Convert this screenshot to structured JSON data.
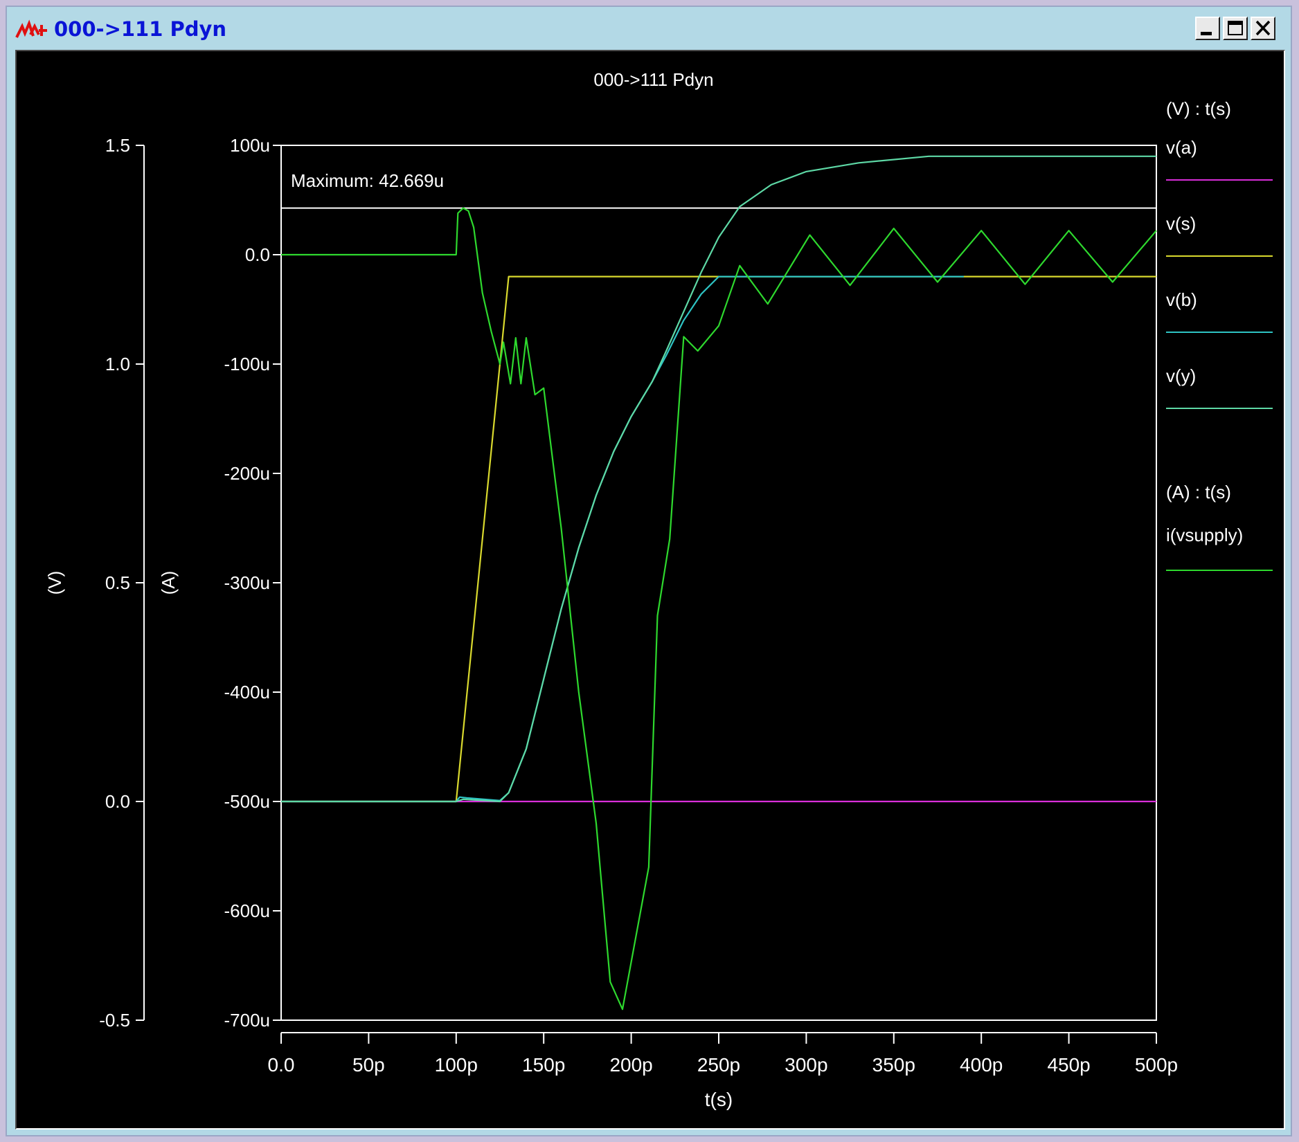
{
  "window": {
    "title": "000->111 Pdyn",
    "icon": "waveform-app-icon",
    "controls": [
      "minimize",
      "maximize",
      "close"
    ]
  },
  "colors": {
    "titlebar_bg": "#b3d9e6",
    "title_text": "#0a14d6",
    "plot_bg": "#000000",
    "v_a": "#d92ed9",
    "v_s": "#d9d92e",
    "v_b": "#2ec4c4",
    "v_y": "#5ed9a6",
    "i_vsupply": "#2ed92e"
  },
  "chart_data": {
    "type": "line",
    "title": "000->111 Pdyn",
    "xlabel": "t(s)",
    "x_tick_labels": [
      "0.0",
      "50p",
      "100p",
      "150p",
      "200p",
      "250p",
      "300p",
      "350p",
      "400p",
      "450p",
      "500p"
    ],
    "xlim": [
      0,
      500
    ],
    "x_unit": "ps",
    "left_axis": {
      "label": "(V)",
      "ylim": [
        -0.5,
        1.5
      ],
      "tick_labels": [
        "1.5",
        "1.0",
        "0.5",
        "0.0",
        "-0.5"
      ]
    },
    "right_axis": {
      "label": "(A)",
      "ylim": [
        -700,
        100
      ],
      "tick_labels": [
        "100u",
        "0.0",
        "-100u",
        "-200u",
        "-300u",
        "-400u",
        "-500u",
        "-600u",
        "-700u"
      ]
    },
    "annotation": {
      "text": "Maximum: 42.669u",
      "value_uA": 42.669
    },
    "legend": {
      "placement": "right",
      "voltage_header": "(V) : t(s)",
      "current_header": "(A) : t(s)"
    },
    "series": [
      {
        "name": "v(a)",
        "axis": "V",
        "color": "#d92ed9",
        "points": [
          [
            0,
            0
          ],
          [
            500,
            0
          ]
        ]
      },
      {
        "name": "v(s)",
        "axis": "V",
        "color": "#d9d92e",
        "points": [
          [
            0,
            0
          ],
          [
            100,
            0
          ],
          [
            130,
            1.2
          ],
          [
            500,
            1.2
          ]
        ]
      },
      {
        "name": "v(b)",
        "axis": "V",
        "color": "#2ec4c4",
        "points": [
          [
            0,
            0
          ],
          [
            100,
            0
          ],
          [
            102,
            0.01
          ],
          [
            106,
            0.008
          ],
          [
            125,
            0.002
          ],
          [
            130,
            0.02
          ],
          [
            140,
            0.12
          ],
          [
            150,
            0.28
          ],
          [
            160,
            0.44
          ],
          [
            170,
            0.58
          ],
          [
            180,
            0.7
          ],
          [
            190,
            0.8
          ],
          [
            200,
            0.88
          ],
          [
            212,
            0.96
          ],
          [
            220,
            1.02
          ],
          [
            230,
            1.1
          ],
          [
            240,
            1.16
          ],
          [
            250,
            1.2
          ],
          [
            260,
            1.2
          ],
          [
            270,
            1.2
          ],
          [
            300,
            1.2
          ],
          [
            390,
            1.2
          ]
        ]
      },
      {
        "name": "v(y)",
        "axis": "V",
        "color": "#5ed9a6",
        "points": [
          [
            0,
            0
          ],
          [
            100,
            0
          ],
          [
            104,
            0.005
          ],
          [
            125,
            0.0
          ],
          [
            130,
            0.02
          ],
          [
            140,
            0.12
          ],
          [
            150,
            0.28
          ],
          [
            160,
            0.44
          ],
          [
            170,
            0.58
          ],
          [
            180,
            0.7
          ],
          [
            190,
            0.8
          ],
          [
            200,
            0.88
          ],
          [
            212,
            0.96
          ],
          [
            220,
            1.03
          ],
          [
            230,
            1.12
          ],
          [
            240,
            1.21
          ],
          [
            250,
            1.29
          ],
          [
            262,
            1.36
          ],
          [
            280,
            1.41
          ],
          [
            300,
            1.44
          ],
          [
            330,
            1.46
          ],
          [
            370,
            1.475
          ],
          [
            500,
            1.475
          ]
        ]
      },
      {
        "name": "i(vsupply)",
        "axis": "A",
        "color": "#2ed92e",
        "points": [
          [
            0,
            0
          ],
          [
            100,
            0
          ],
          [
            101,
            38
          ],
          [
            104,
            42.669
          ],
          [
            107,
            40
          ],
          [
            110,
            25
          ],
          [
            115,
            -35
          ],
          [
            120,
            -70
          ],
          [
            125,
            -100
          ],
          [
            127,
            -80
          ],
          [
            131,
            -118
          ],
          [
            134,
            -76
          ],
          [
            137,
            -118
          ],
          [
            140,
            -76
          ],
          [
            145,
            -128
          ],
          [
            150,
            -122
          ],
          [
            160,
            -250
          ],
          [
            170,
            -400
          ],
          [
            180,
            -520
          ],
          [
            188,
            -665
          ],
          [
            195,
            -690
          ],
          [
            210,
            -560
          ],
          [
            215,
            -330
          ],
          [
            222,
            -260
          ],
          [
            230,
            -75
          ],
          [
            238,
            -88
          ],
          [
            250,
            -65
          ],
          [
            262,
            -10
          ],
          [
            278,
            -45
          ],
          [
            302,
            18
          ],
          [
            325,
            -28
          ],
          [
            350,
            24
          ],
          [
            375,
            -25
          ],
          [
            400,
            22
          ],
          [
            425,
            -27
          ],
          [
            450,
            22
          ],
          [
            475,
            -25
          ],
          [
            500,
            22
          ]
        ]
      }
    ]
  }
}
